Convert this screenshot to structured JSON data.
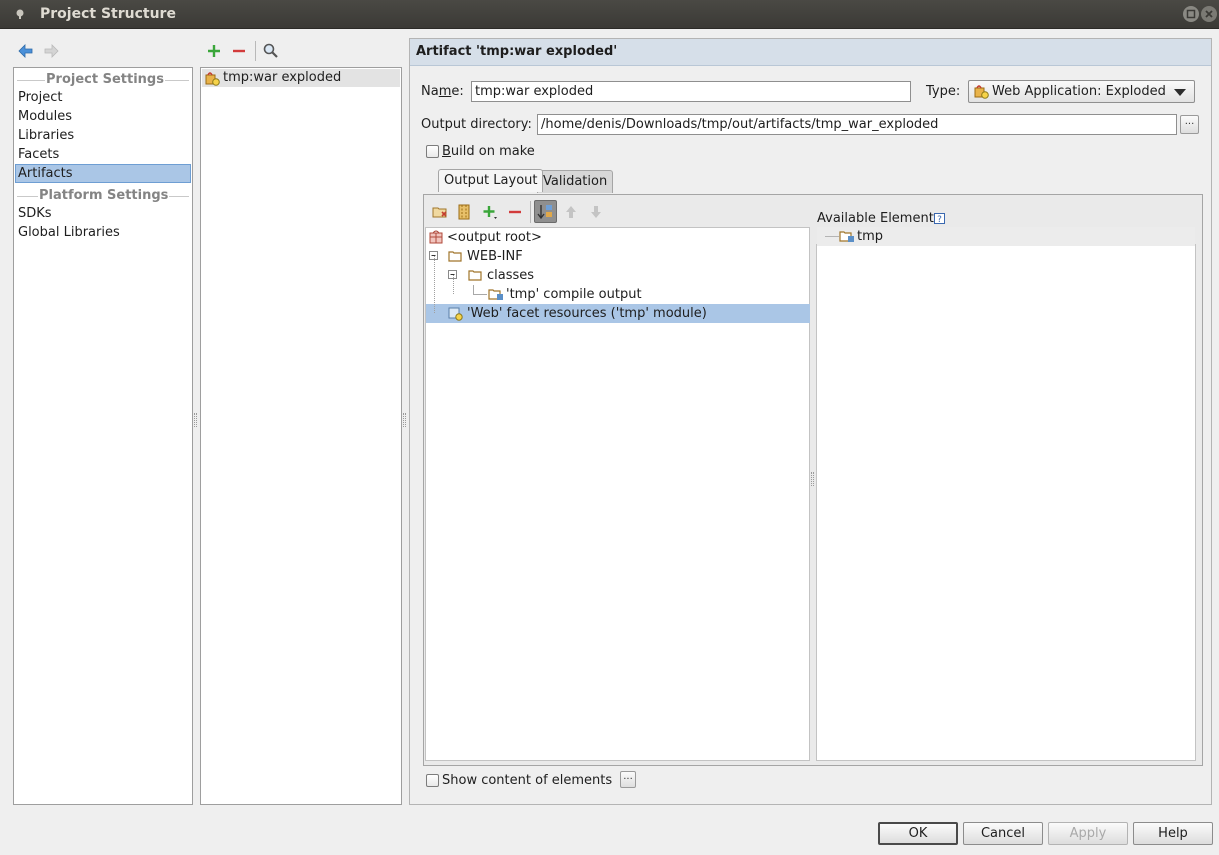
{
  "window": {
    "title": "Project Structure"
  },
  "left_nav": {
    "section_project": "Project Settings",
    "section_platform": "Platform Settings",
    "items_project": [
      "Project",
      "Modules",
      "Libraries",
      "Facets",
      "Artifacts"
    ],
    "items_platform": [
      "SDKs",
      "Global Libraries"
    ],
    "selected": "Artifacts"
  },
  "artifacts_list": {
    "items": [
      "tmp:war exploded"
    ]
  },
  "artifact": {
    "header": "Artifact 'tmp:war exploded'",
    "name_label": "Name:",
    "name_value": "tmp:war exploded",
    "type_label": "Type:",
    "type_value": "Web Application: Exploded",
    "output_dir_label": "Output directory:",
    "output_dir_value": "/home/denis/Downloads/tmp/out/artifacts/tmp_war_exploded",
    "browse_label": "...",
    "build_on_make_label": "Build on make",
    "build_on_make_checked": false,
    "tabs": [
      "Output Layout",
      "Validation"
    ],
    "active_tab": "Output Layout",
    "tree": [
      {
        "label": "<output root>"
      },
      {
        "label": "WEB-INF"
      },
      {
        "label": "classes"
      },
      {
        "label": "'tmp' compile output"
      },
      {
        "label": "'Web' facet resources ('tmp' module)"
      }
    ],
    "available_elements_label": "Available Elements",
    "available_elements": [
      "tmp"
    ],
    "show_content_label": "Show content of elements",
    "show_content_checked": false,
    "show_content_more": "..."
  },
  "buttons": {
    "ok": "OK",
    "cancel": "Cancel",
    "apply": "Apply",
    "help": "Help"
  },
  "colors": {
    "selection": "#aac6e6",
    "header_bg": "#d6dfe9",
    "add": "#3aa63a",
    "remove": "#d23b3b",
    "nav_arrow": "#4a90d9"
  }
}
